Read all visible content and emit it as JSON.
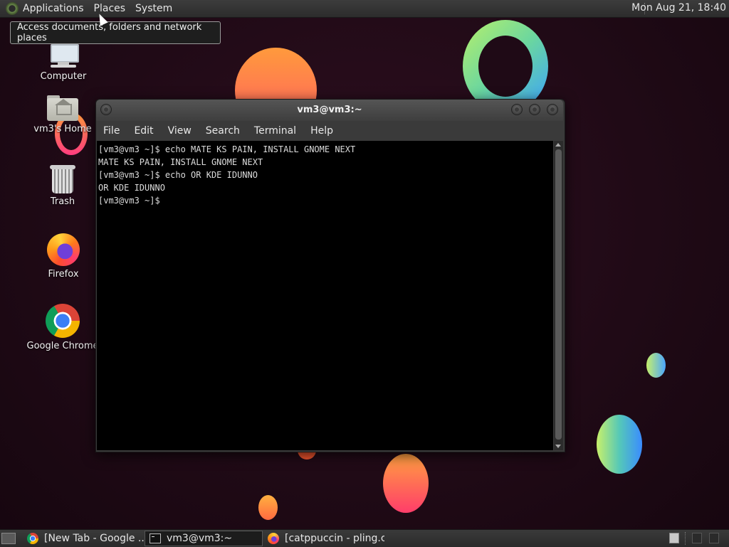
{
  "top_panel": {
    "menus": [
      "Applications",
      "Places",
      "System"
    ],
    "clock": "Mon Aug 21, 18:40"
  },
  "tooltip": "Access documents, folders and network places",
  "desktop": {
    "icons": [
      {
        "label": "Computer",
        "icon": "computer-icon"
      },
      {
        "label": "vm3's Home",
        "icon": "home-folder-icon"
      },
      {
        "label": "Trash",
        "icon": "trash-icon"
      },
      {
        "label": "Firefox",
        "icon": "firefox-icon"
      },
      {
        "label": "Google Chrome",
        "icon": "chrome-icon"
      }
    ]
  },
  "terminal": {
    "title": "vm3@vm3:~",
    "menu": [
      "File",
      "Edit",
      "View",
      "Search",
      "Terminal",
      "Help"
    ],
    "lines": [
      "[vm3@vm3 ~]$ echo MATE KS PAIN, INSTALL GNOME NEXT",
      "MATE KS PAIN, INSTALL GNOME NEXT",
      "[vm3@vm3 ~]$ echo OR KDE IDUNNO",
      "OR KDE IDUNNO",
      "[vm3@vm3 ~]$"
    ]
  },
  "taskbar": {
    "tasks": [
      {
        "label": "[New Tab - Google ...",
        "icon": "chrome-icon",
        "active": false
      },
      {
        "label": "vm3@vm3:~",
        "icon": "terminal-icon",
        "active": true
      },
      {
        "label": "[catppuccin - pling.c...",
        "icon": "firefox-icon",
        "active": false
      }
    ]
  }
}
